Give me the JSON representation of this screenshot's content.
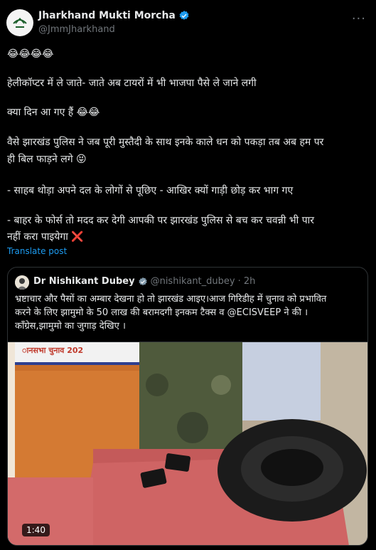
{
  "post": {
    "author_name": "Jharkhand Mukti Morcha",
    "author_handle": "@JmmJharkhand",
    "more_label": "···",
    "lines": [
      "😂😂😂😂",
      "हेलीकॉप्टर में ले जाते-  जाते अब टायरों में भी भाजपा पैसे ले जाने लगी",
      "क्या दिन आ गए हैं 😂😂",
      "वैसे झारखंड पुलिस ने जब पूरी मुस्तैदी के साथ इनके काले धन को पकड़ा तब अब हम पर",
      "ही बिल फाड़ने लगे 😝",
      "- साहब थोड़ा अपने दल के लोगों से पूछिए - आखिर क्यों गाड़ी छोड़ कर भाग गए",
      "- बाहर के फोर्स तो मदद कर देगी आपकी पर झारखंड पुलिस से बच कर चवन्नी भी पार",
      "नहीं करा पाइयेगा ❌"
    ],
    "translate_label": "Translate post"
  },
  "quote": {
    "author_name": "Dr Nishikant Dubey",
    "author_handle": "@nishikant_dubey",
    "time": "· 2h",
    "lines": [
      "भ्रष्टाचार और पैसों का अम्बार देखना हो तो झारखंड आइए।आज गिरिडीह में चुनाव को प्रभावित",
      "करने के लिए झामुमो के 50 लाख  की बरामदगी इनकम टैक्स व @ECISVEEP ने की ।",
      "कॉंग्रेस,झामुमो का जुगाड़ देखिए ।"
    ],
    "banner_text": "ानसभा चुनाव 202",
    "video_duration": "1:40"
  },
  "colors": {
    "accent": "#1d9bf0",
    "muted": "#71767b",
    "text": "#e7e9ea",
    "background": "#000000",
    "border": "#2f3336"
  }
}
